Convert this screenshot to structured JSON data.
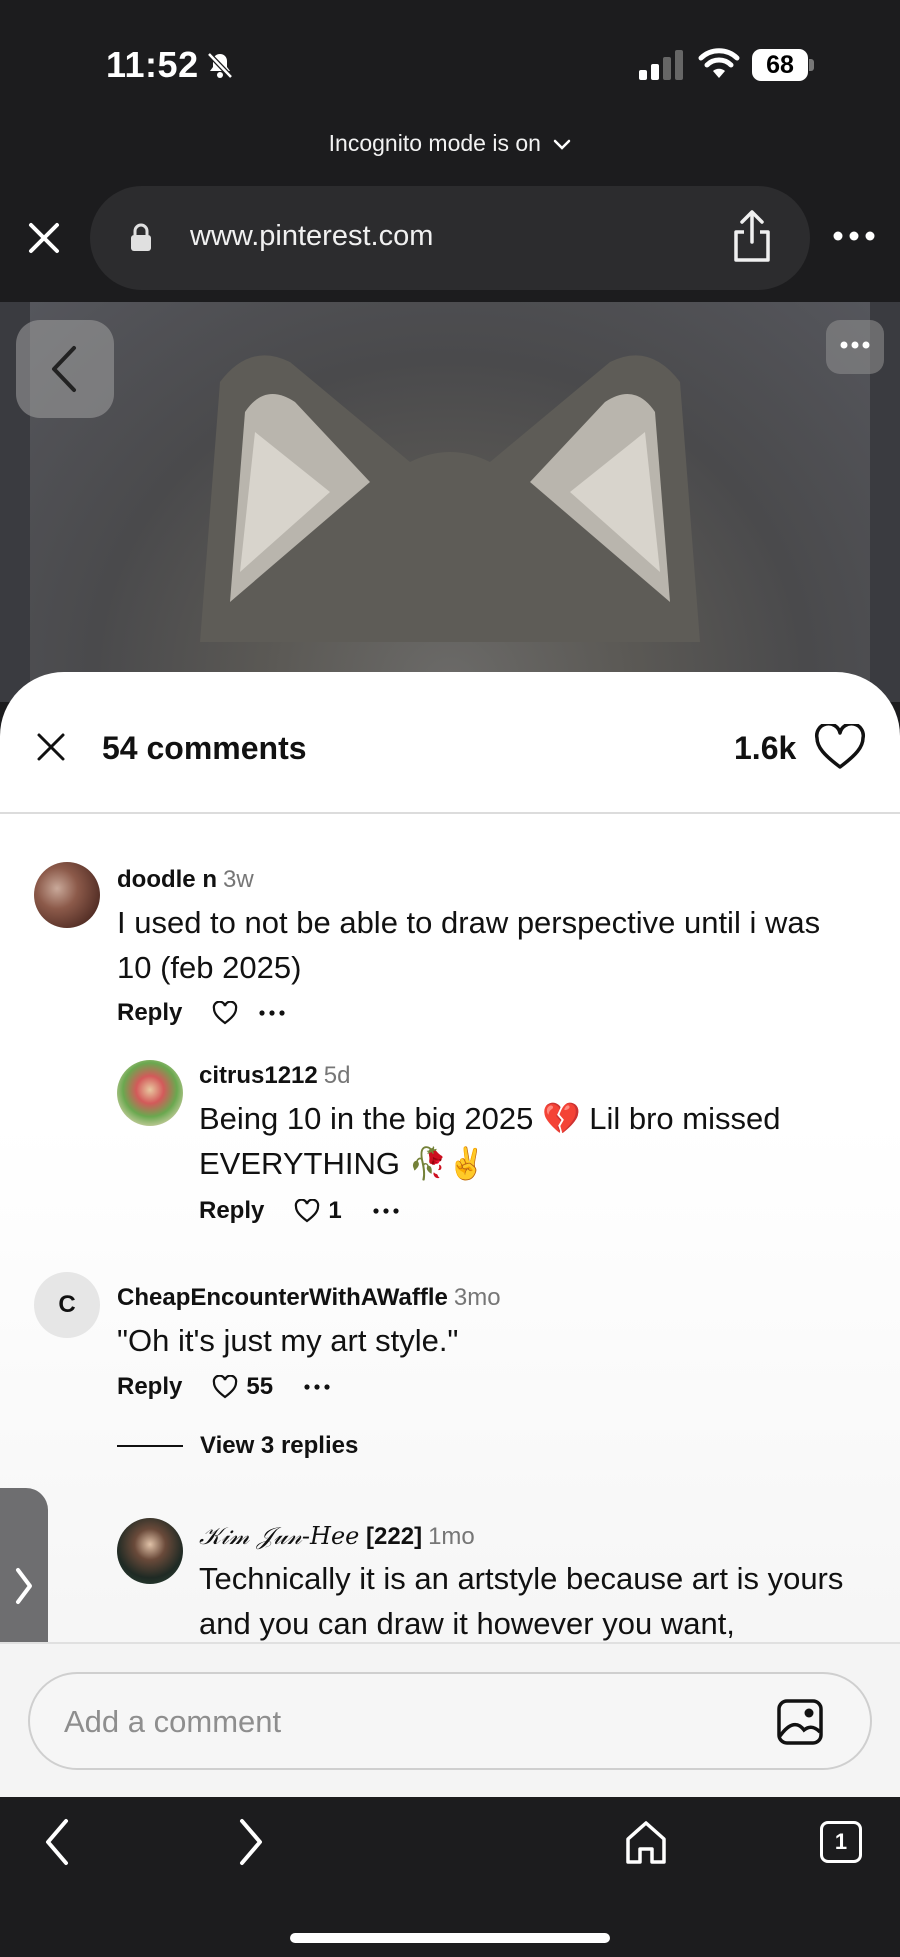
{
  "status_bar": {
    "time": "11:52",
    "battery": "68"
  },
  "browser": {
    "mode_label": "Incognito mode is on",
    "url": "www.pinterest.com",
    "tab_count": "1"
  },
  "sheet": {
    "title": "54 comments",
    "likes": "1.6k"
  },
  "comments": [
    {
      "user": "doodle n",
      "age": "3w",
      "text": "I used to not be able to draw perspective until i was 10 (feb 2025)",
      "reply_label": "Reply",
      "likes": ""
    },
    {
      "user": "citrus1212",
      "age": "5d",
      "text": "Being 10 in the big 2025 💔 Lil bro missed EVERYTHING 🥀✌️",
      "reply_label": "Reply",
      "likes": "1"
    },
    {
      "user": "CheapEncounterWithAWaffle",
      "age": "3mo",
      "avatar_initial": "C",
      "text": "\"Oh it's just my art style.\"",
      "reply_label": "Reply",
      "likes": "55",
      "view_replies": "View 3 replies"
    },
    {
      "user": "𝒦𝒾𝓂 𝒥𝓊𝓃-𝐻𝑒𝑒",
      "user_suffix": "[222]",
      "age": "1mo",
      "text": "Technically it is an artstyle because art is yours and you can draw it however you want,"
    }
  ],
  "add_comment": {
    "placeholder": "Add a comment"
  },
  "colors": {
    "chrome_bg": "#1c1c1e",
    "sheet_bg": "#ffffff",
    "text": "#111111",
    "muted": "#767676"
  }
}
